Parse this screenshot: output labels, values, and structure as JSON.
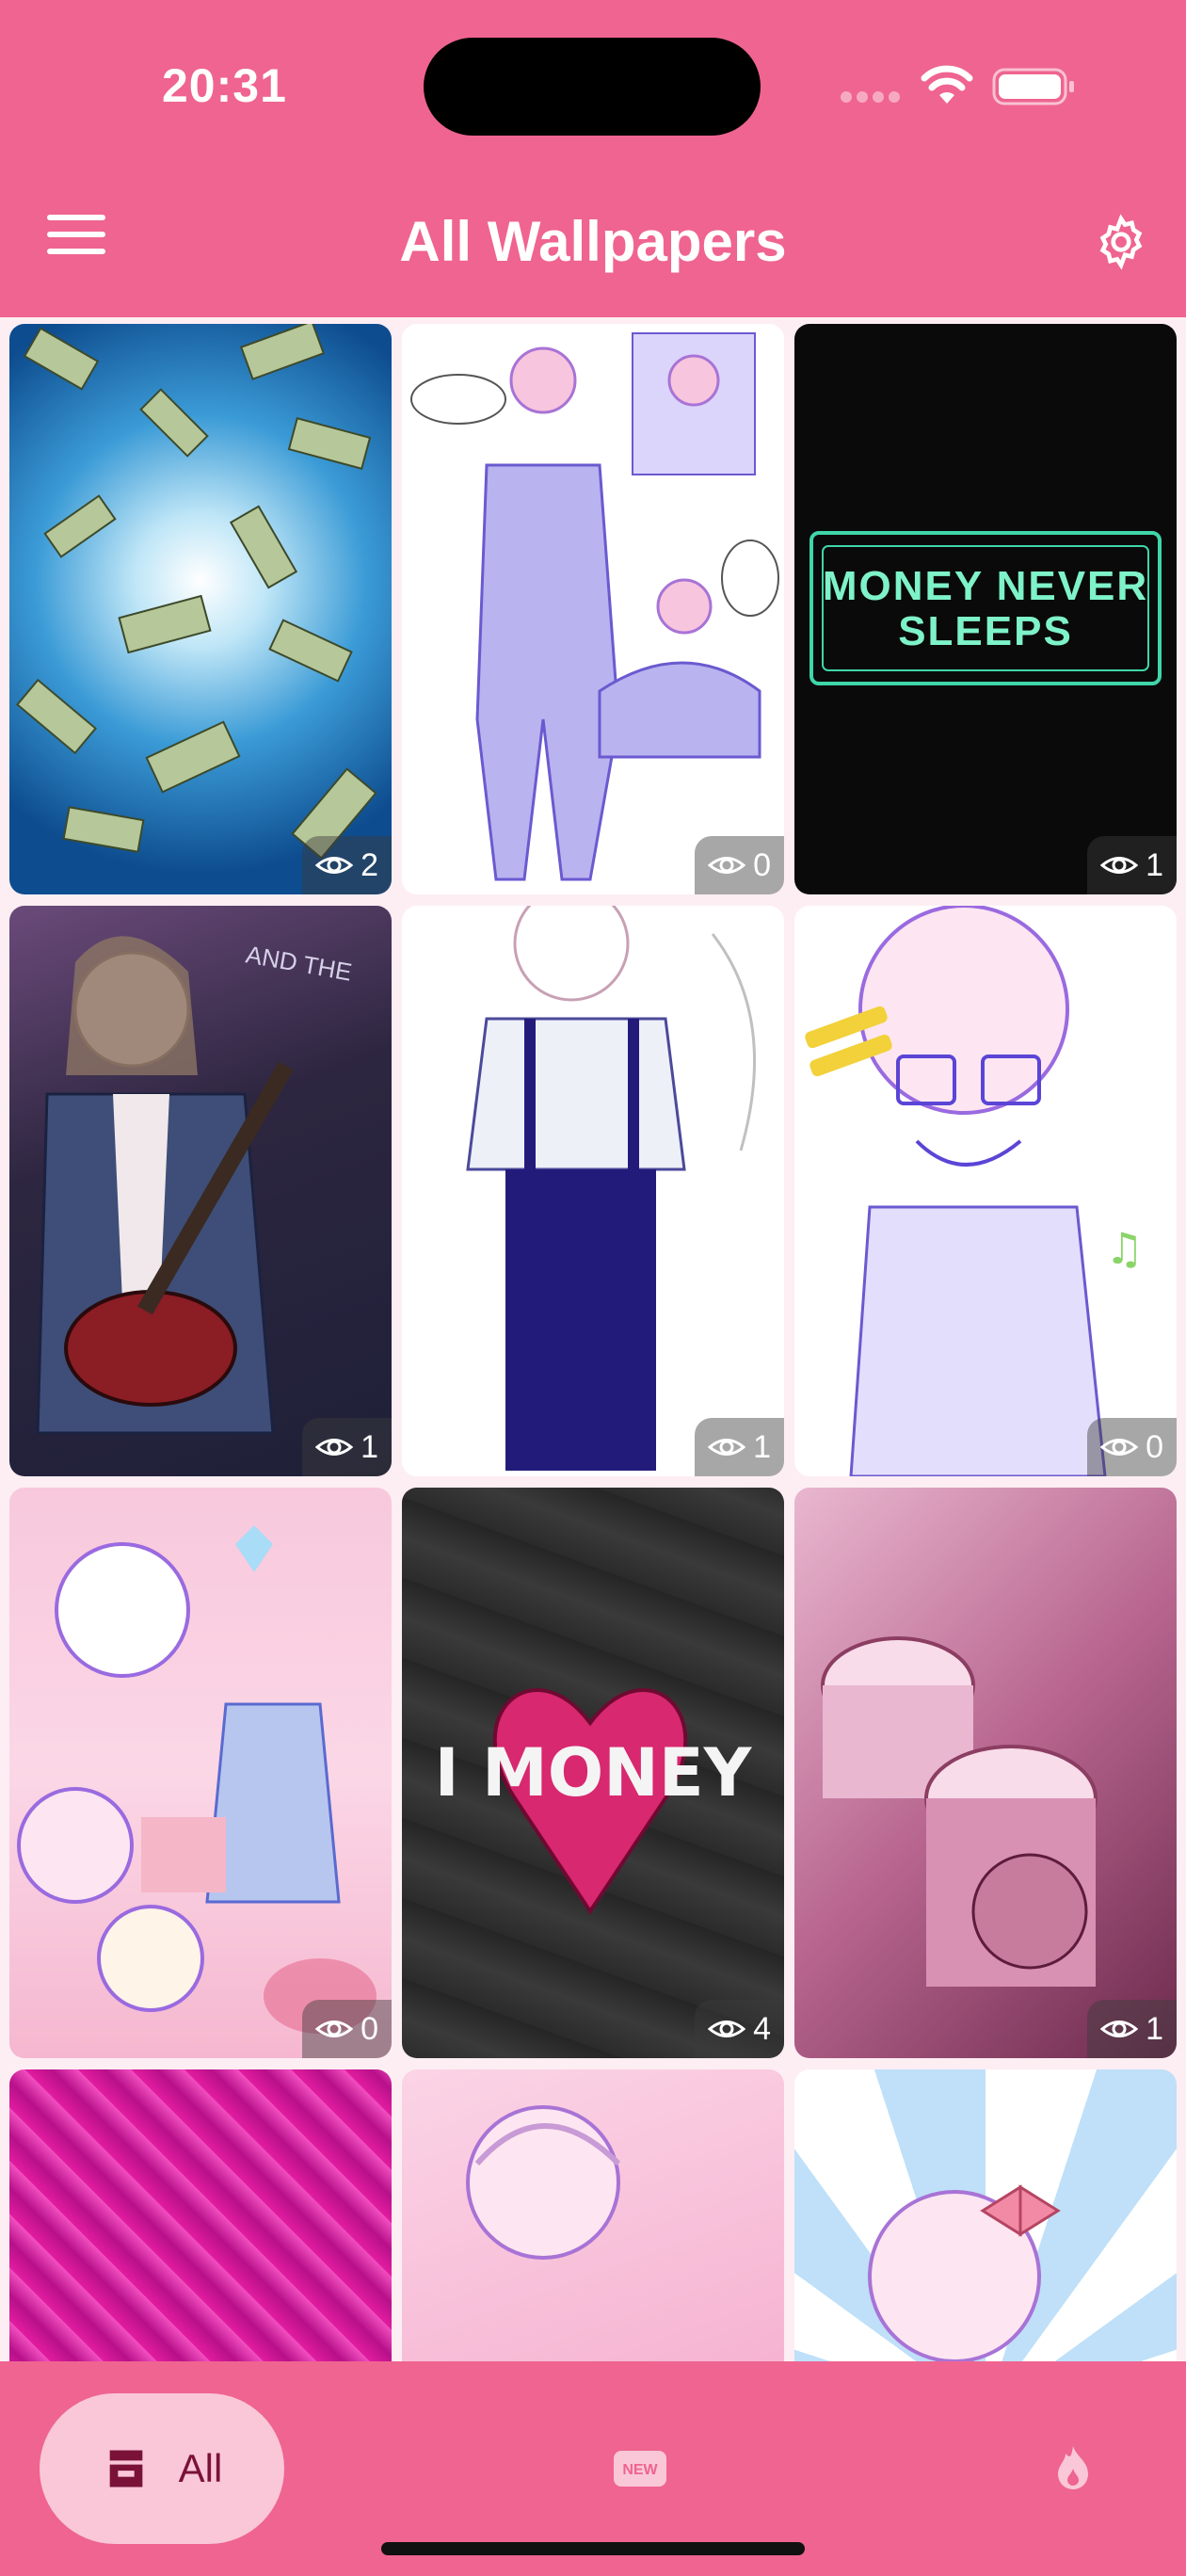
{
  "status_bar": {
    "time": "20:31"
  },
  "header": {
    "title": "All Wallpapers",
    "menu_icon": "hamburger-menu-icon",
    "settings_icon": "gear-icon"
  },
  "wallpapers": [
    {
      "views": "2",
      "caption": ""
    },
    {
      "views": "0",
      "caption": ""
    },
    {
      "views": "1",
      "caption": "MONEY NEVER SLEEPS"
    },
    {
      "views": "1",
      "caption": ""
    },
    {
      "views": "1",
      "caption": ""
    },
    {
      "views": "0",
      "caption": ""
    },
    {
      "views": "0",
      "caption": ""
    },
    {
      "views": "4",
      "caption": "I MONEY"
    },
    {
      "views": "1",
      "caption": ""
    },
    {
      "views": "",
      "caption": ""
    },
    {
      "views": "",
      "caption": ""
    },
    {
      "views": "",
      "caption": ""
    }
  ],
  "bottom_nav": {
    "all_label": "All",
    "all_icon": "inbox-tray-icon",
    "new_icon": "new-badge-icon",
    "new_badge_text": "NEW",
    "hot_icon": "flame-icon"
  },
  "colors": {
    "primary": "#ef6490",
    "tab_active_bg": "#f9c7d8",
    "background": "#fdeef3"
  }
}
